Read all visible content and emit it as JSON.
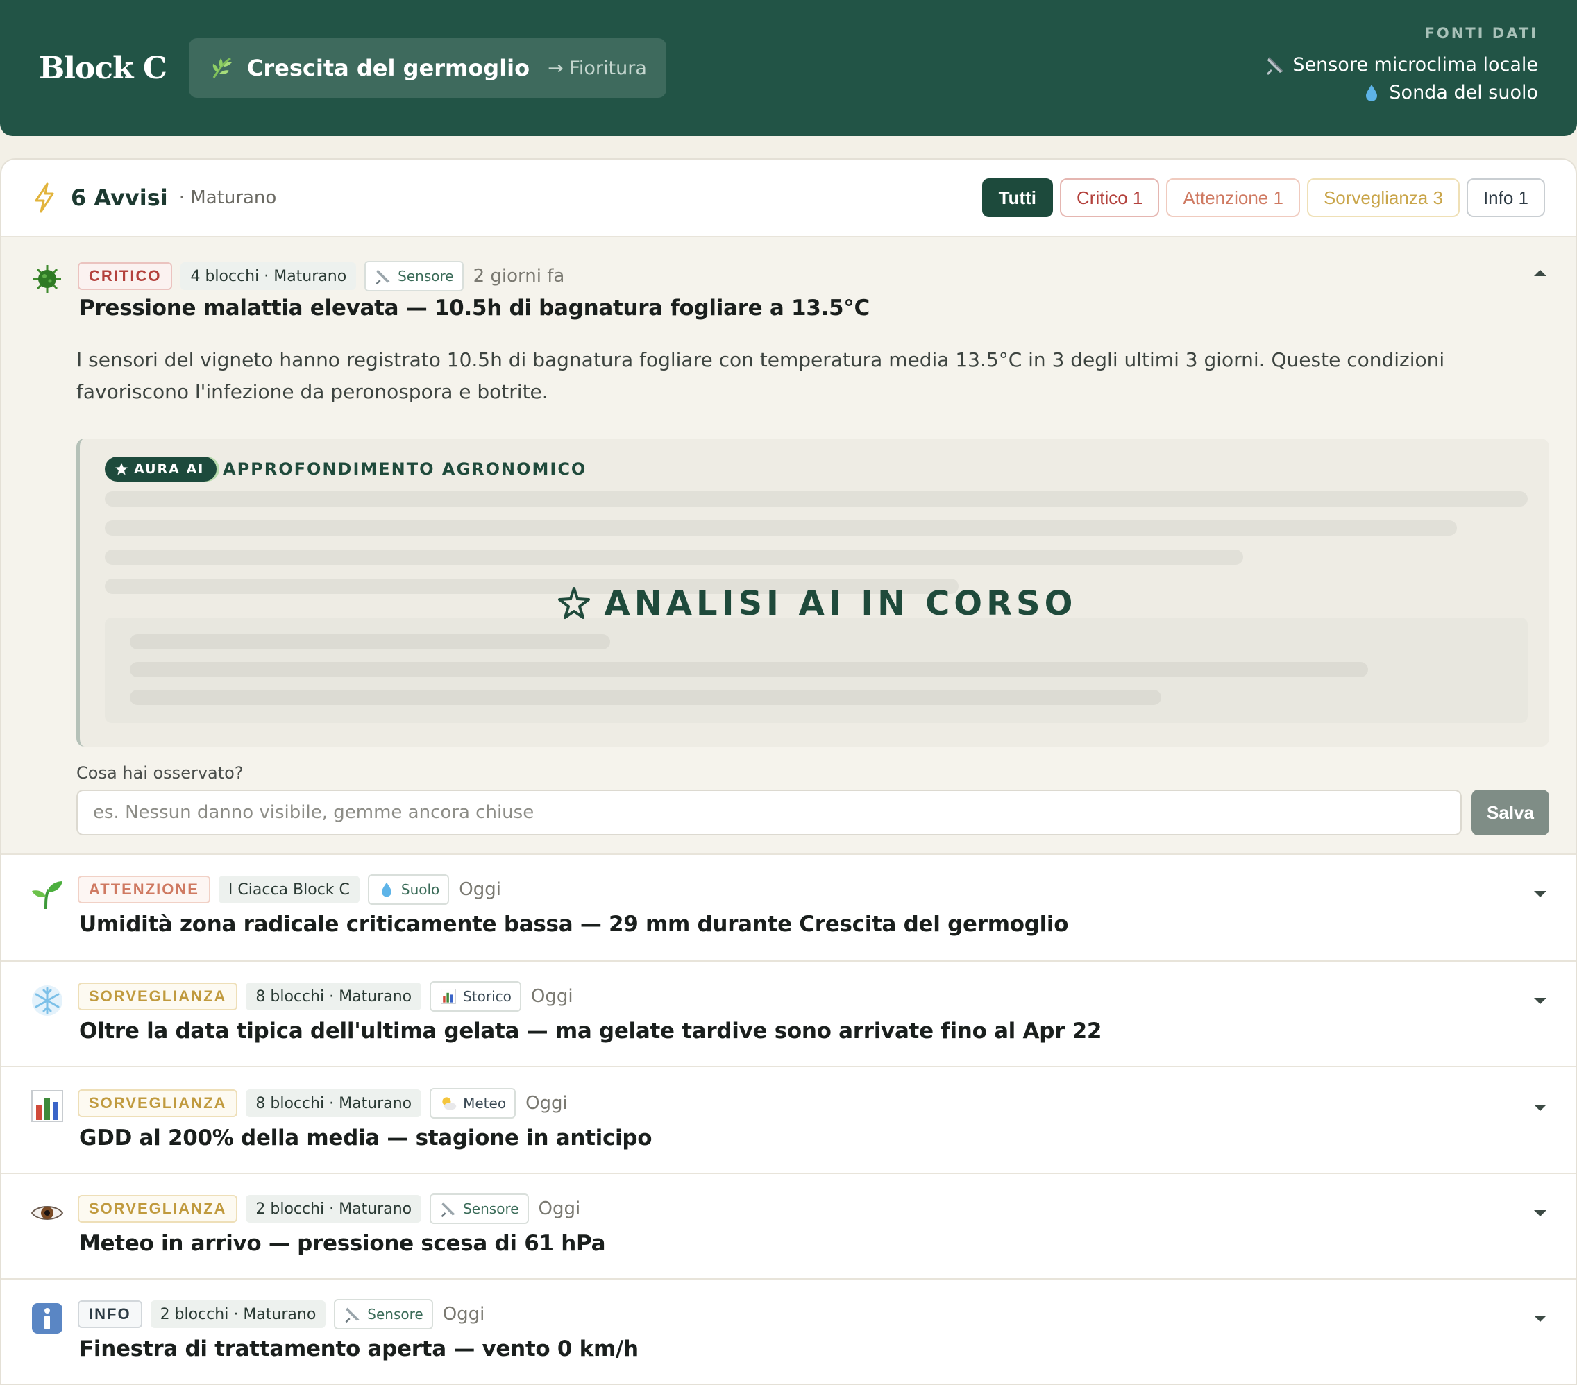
{
  "header": {
    "block": "Block C",
    "stage_current": "Crescita del germoglio",
    "stage_next": "→ Fioritura",
    "sources_title": "FONTI DATI",
    "sources": [
      {
        "icon": "satellite-icon",
        "label": "Sensore microclima locale"
      },
      {
        "icon": "droplet-icon",
        "label": "Sonda del suolo"
      }
    ]
  },
  "panel": {
    "count_label": "6 Avvisi",
    "sub_label": "· Maturano",
    "filters": {
      "all": "Tutti",
      "critical": "Critico 1",
      "attention": "Attenzione 1",
      "watch": "Sorveglianza 3",
      "info": "Info 1"
    }
  },
  "alerts": [
    {
      "icon": "virus-icon",
      "severity": "CRITICO",
      "scope": "4 blocchi · Maturano",
      "source": "Sensore",
      "source_icon": "satellite-icon",
      "when": "2 giorni fa",
      "title": "Pressione malattia elevata — 10.5h di bagnatura fogliare a 13.5°C",
      "description": "I sensori del vigneto hanno registrato 10.5h di bagnatura fogliare con temperatura media 13.5°C in 3 degli ultimi 3 giorni. Queste condizioni favoriscono l'infezione da peronospora e botrite.",
      "ai_badge": "AURA AI",
      "ai_title": "APPROFONDIMENTO AGRONOMICO",
      "ai_status": "ANALISI AI IN CORSO",
      "obs_label": "Cosa hai osservato?",
      "obs_placeholder": "es. Nessun danno visibile, gemme ancora chiuse",
      "save": "Salva"
    },
    {
      "icon": "sprout-icon",
      "severity": "ATTENZIONE",
      "scope": "I Ciacca Block C",
      "source": "Suolo",
      "source_icon": "droplet-icon",
      "when": "Oggi",
      "title": "Umidità zona radicale criticamente bassa — 29 mm durante Crescita del germoglio"
    },
    {
      "icon": "snowflake-icon",
      "severity": "SORVEGLIANZA",
      "scope": "8 blocchi · Maturano",
      "source": "Storico",
      "source_icon": "bar-chart-icon",
      "when": "Oggi",
      "title": "Oltre la data tipica dell'ultima gelata — ma gelate tardive sono arrivate fino al Apr 22"
    },
    {
      "icon": "bar-chart-icon",
      "severity": "SORVEGLIANZA",
      "scope": "8 blocchi · Maturano",
      "source": "Meteo",
      "source_icon": "sun-cloud-icon",
      "when": "Oggi",
      "title": "GDD al 200% della media — stagione in anticipo"
    },
    {
      "icon": "eye-icon",
      "severity": "SORVEGLIANZA",
      "scope": "2 blocchi · Maturano",
      "source": "Sensore",
      "source_icon": "satellite-icon",
      "when": "Oggi",
      "title": "Meteo in arrivo — pressione scesa di 61 hPa"
    },
    {
      "icon": "info-icon",
      "severity": "INFO",
      "scope": "2 blocchi · Maturano",
      "source": "Sensore",
      "source_icon": "satellite-icon",
      "when": "Oggi",
      "title": "Finestra di trattamento aperta — vento 0 km/h"
    }
  ]
}
